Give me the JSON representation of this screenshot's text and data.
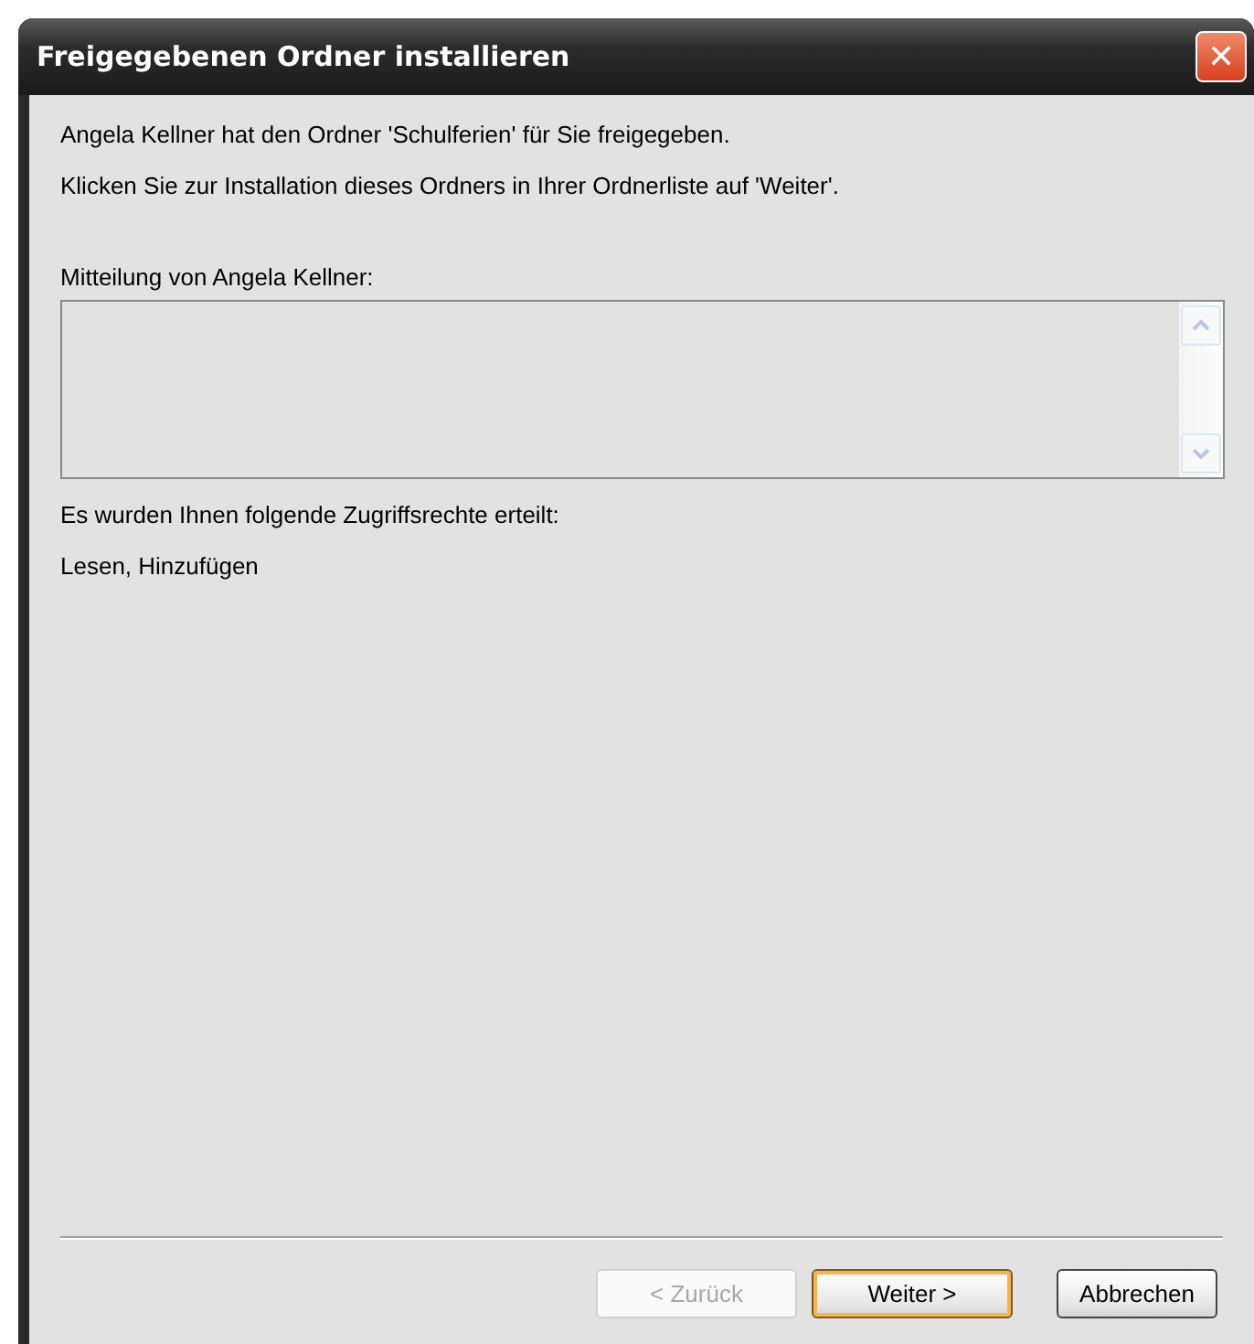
{
  "window": {
    "title": "Freigegebenen Ordner installieren",
    "close": "✕"
  },
  "intro": "Angela Kellner hat den Ordner 'Schulferien' für Sie freigegeben.",
  "instruction": "Klicken Sie zur Installation dieses Ordners in Ihrer Ordnerliste auf 'Weiter'.",
  "message": {
    "label": "Mitteilung von Angela Kellner:",
    "disabled": true
  },
  "rights_label": "Es wurden Ihnen folgende Zugriffsrechte erteilt:",
  "rights": "Lesen, Hinzufügen",
  "buttons": [
    {
      "label": "< Zurück",
      "disabled": true,
      "default": false
    },
    {
      "label": "Weiter >",
      "disabled": false,
      "default": true
    },
    {
      "label": "Abbrechen",
      "disabled": false,
      "default": false
    }
  ]
}
